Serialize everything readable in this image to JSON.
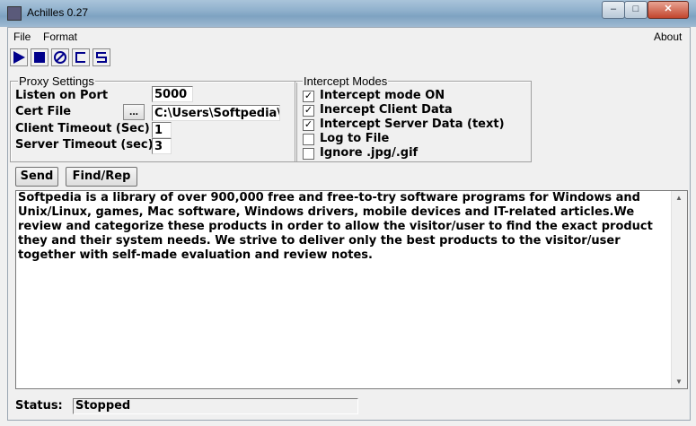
{
  "window": {
    "title": "Achilles 0.27"
  },
  "menu": {
    "file": "File",
    "format": "Format",
    "about": "About"
  },
  "toolbar": {
    "icons": [
      "play-icon",
      "stop-icon",
      "no-entry-icon",
      "c-icon",
      "s-icon"
    ]
  },
  "proxy_settings": {
    "legend": "Proxy Settings",
    "listen_on_port_label": "Listen on Port",
    "listen_on_port_value": "5000",
    "cert_file_label": "Cert File",
    "cert_browse_label": "...",
    "cert_file_value": "C:\\Users\\Softpedia\\Do",
    "client_timeout_label": "Client Timeout (Sec)",
    "client_timeout_value": "1",
    "server_timeout_label": "Server Timeout (sec)",
    "server_timeout_value": "3"
  },
  "intercept_modes": {
    "legend": "Intercept Modes",
    "options": [
      {
        "label": "Intercept mode ON",
        "checked": true
      },
      {
        "label": "Inercept Client Data",
        "checked": true
      },
      {
        "label": "Intercept Server Data (text)",
        "checked": true
      },
      {
        "label": "Log to File",
        "checked": false
      },
      {
        "label": "Ignore .jpg/.gif",
        "checked": false
      }
    ]
  },
  "actions": {
    "send": "Send",
    "find_replace": "Find/Rep"
  },
  "body_text": "Softpedia is a library of over 900,000 free and free-to-try software programs for Windows and Unix/Linux, games, Mac software, Windows drivers, mobile devices and IT-related articles.We review and categorize these products in order to allow the visitor/user to find the exact product they and their system needs. We strive to deliver only the best products to the visitor/user together with self-made evaluation and review notes.",
  "status": {
    "label": "Status:",
    "value": "Stopped"
  },
  "colors": {
    "toolbar_icon": "#00008b",
    "title_bar": "#8fb0cc"
  }
}
